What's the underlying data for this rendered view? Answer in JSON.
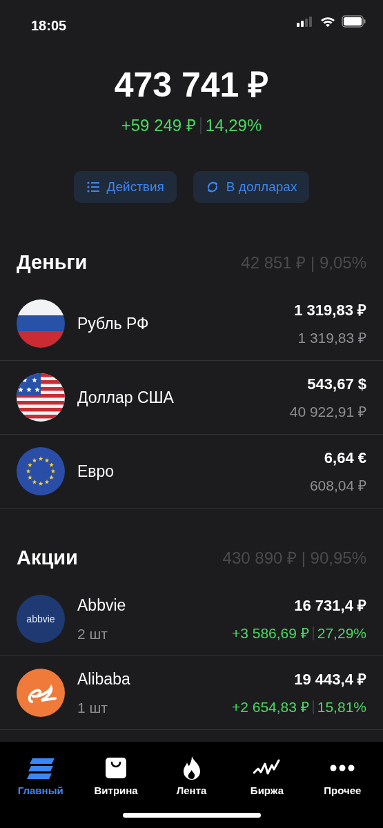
{
  "status_bar": {
    "time": "18:05"
  },
  "portfolio": {
    "total": "473 741 ₽",
    "change": "+59 249 ₽",
    "change_percent": "14,29%"
  },
  "actions": [
    {
      "label": "Действия",
      "kind": "list"
    },
    {
      "label": "В долларах",
      "kind": "refresh"
    }
  ],
  "sections": [
    {
      "title": "Деньги",
      "summary": "42 851 ₽ | 9,05%",
      "items": [
        {
          "kind": "currency",
          "name": "Рубль РФ",
          "amount": "1 319,83 ₽",
          "value_rub": "1 319,83 ₽"
        },
        {
          "kind": "currency",
          "name": "Доллар США",
          "amount": "543,67 $",
          "value_rub": "40 922,91 ₽"
        },
        {
          "kind": "currency",
          "name": "Евро",
          "amount": "6,64 €",
          "value_rub": "608,04 ₽"
        }
      ]
    },
    {
      "title": "Акции",
      "summary": "430 890 ₽ | 90,95%",
      "items": [
        {
          "kind": "stock",
          "name": "Abbvie",
          "logo_text": "abbvie",
          "quantity": "2 шт",
          "value": "16 731,4 ₽",
          "change": "+3 586,69 ₽",
          "change_percent": "27,29%"
        },
        {
          "kind": "stock",
          "name": "Alibaba",
          "quantity": "1 шт",
          "value": "19 443,4 ₽",
          "change": "+2 654,83 ₽",
          "change_percent": "15,81%"
        }
      ]
    }
  ],
  "tab_bar": [
    {
      "label": "Главный",
      "selected": true
    },
    {
      "label": "Витрина",
      "selected": false
    },
    {
      "label": "Лента",
      "selected": false
    },
    {
      "label": "Биржа",
      "selected": false
    },
    {
      "label": "Прочее",
      "selected": false
    }
  ]
}
